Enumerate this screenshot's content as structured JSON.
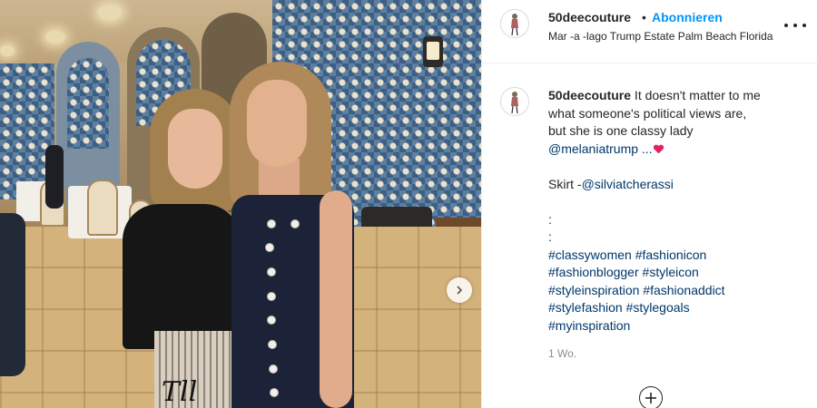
{
  "post": {
    "username": "50deecouture",
    "separator": "•",
    "follow_label": "Abonnieren",
    "location": "Mar -a -lago Trump Estate Palm Beach Florida"
  },
  "caption": {
    "username": "50deecouture",
    "line1": " It doesn't matter to me",
    "line2": "what someone's political views are,",
    "line3": "but she is one classy lady",
    "mention_melania": "@melaniatrump",
    "ellipsis": " ...",
    "skirt_prefix": "Skirt -",
    "mention_silvia": "@silviatcherassi",
    "dot1": ":",
    "dot2": ":",
    "hashtag_rows": [
      [
        "#classywomen",
        "#fashionicon"
      ],
      [
        "#fashionblogger",
        "#styleicon"
      ],
      [
        "#styleinspiration",
        "#fashionaddict"
      ],
      [
        "#stylefashion",
        "#stylegoals"
      ],
      [
        "#myinspiration"
      ]
    ]
  },
  "meta": {
    "age": "1 Wo."
  },
  "photo": {
    "skirt_print": "Tll"
  },
  "icons": {
    "more": "more-horizontal-icon",
    "next": "chevron-right-icon",
    "load_more": "plus-circle-icon",
    "heart": "red-heart-emoji-icon"
  },
  "colors": {
    "link": "#00376b",
    "follow": "#0095f6",
    "text": "#262626",
    "muted": "#8e8e8e"
  }
}
